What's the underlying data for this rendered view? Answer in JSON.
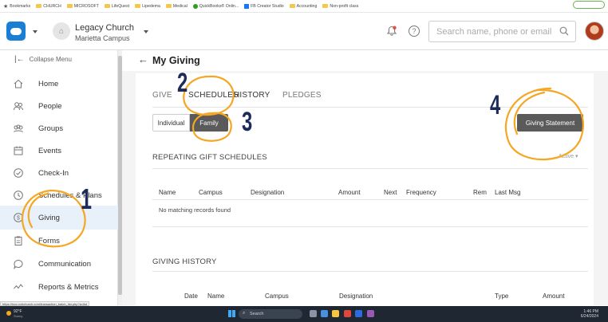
{
  "bookmarks": {
    "items": [
      "Bookmarks",
      "CHURCH",
      "MICROSOFT",
      "LifeQuest",
      "Lipedema",
      "Medical",
      "QuickBooks® Onlin...",
      "FB Creator Studio",
      "Accounting",
      "Non-profit class"
    ]
  },
  "header": {
    "church_name": "Legacy Church",
    "campus": "Marietta Campus",
    "search_placeholder": "Search name, phone or email",
    "help_label": "?"
  },
  "sidebar": {
    "collapse_label": "Collapse Menu",
    "items": [
      {
        "label": "Home",
        "icon": "home-icon"
      },
      {
        "label": "People",
        "icon": "people-icon"
      },
      {
        "label": "Groups",
        "icon": "groups-icon"
      },
      {
        "label": "Events",
        "icon": "calendar-icon"
      },
      {
        "label": "Check-In",
        "icon": "check-circle-icon"
      },
      {
        "label": "Schedules & Plans",
        "icon": "clock-icon"
      },
      {
        "label": "Giving",
        "icon": "dollar-icon"
      },
      {
        "label": "Forms",
        "icon": "clipboard-icon"
      },
      {
        "label": "Communication",
        "icon": "chat-icon"
      },
      {
        "label": "Reports & Metrics",
        "icon": "chart-icon"
      }
    ]
  },
  "main": {
    "title": "My Giving",
    "tabs": [
      "GIVE",
      "SCHEDULES",
      "HISTORY",
      "PLEDGES"
    ],
    "segment": {
      "individual": "Individual",
      "family": "Family"
    },
    "giving_statement": "Giving Statement",
    "repeating_title": "REPEATING GIFT SCHEDULES",
    "filter_label": "Active",
    "repeating_columns": [
      "Name",
      "Campus",
      "Designation",
      "Amount",
      "Next",
      "Frequency",
      "Rem",
      "Last Msg"
    ],
    "empty_message": "No matching records found",
    "history_title": "GIVING HISTORY",
    "history_columns": [
      "Date",
      "Name",
      "Campus",
      "Designation",
      "Type",
      "Amount"
    ]
  },
  "status_url": "https://lccc.ccbchurch.com/transaction_batch_list.php?a=list",
  "taskbar": {
    "temperature": "92°F",
    "condition": "Sunny",
    "search_label": "Search",
    "time": "1:46 PM",
    "date": "6/24/2024"
  },
  "annotations": {
    "one": "1",
    "two": "2",
    "three": "3",
    "four": "4"
  },
  "colors": {
    "accent": "#1a7fd4",
    "annotation_circle": "#f5a623",
    "annotation_number": "#1c2b59",
    "dark_button": "#5a5a5a"
  }
}
